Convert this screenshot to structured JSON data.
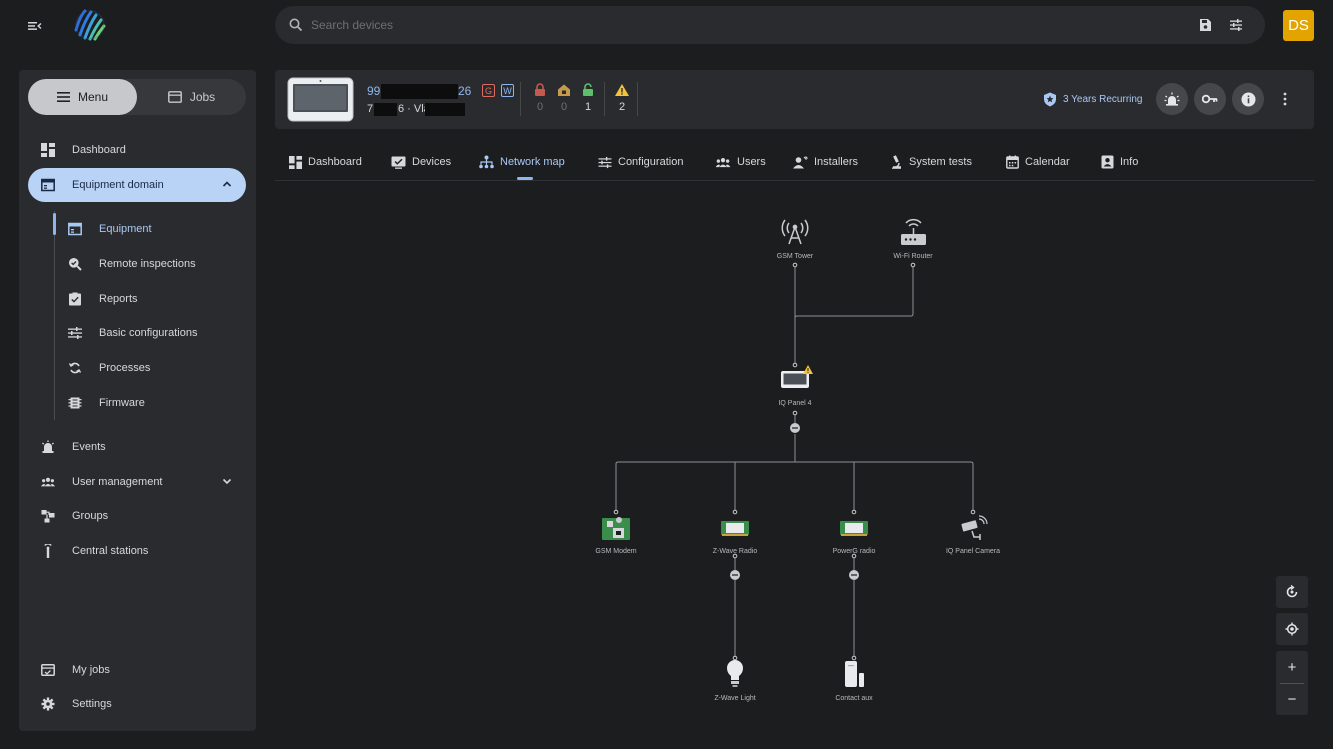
{
  "header": {
    "search_placeholder": "Search devices",
    "avatar_initials": "DS",
    "icons": {
      "menu": "menu-collapse-icon",
      "logo": "brand-logo",
      "search": "search-icon",
      "save": "save-icon",
      "filter": "tune-icon"
    }
  },
  "sidebar": {
    "segment": {
      "menu_label": "Menu",
      "jobs_label": "Jobs",
      "active": "Menu"
    },
    "items": [
      {
        "label": "Dashboard",
        "icon": "dashboard-icon"
      },
      {
        "label": "Equipment domain",
        "icon": "equipment-domain-icon",
        "expanded": true
      },
      {
        "label": "Events",
        "icon": "alarm-icon"
      },
      {
        "label": "User management",
        "icon": "users-icon"
      },
      {
        "label": "Groups",
        "icon": "groups-icon"
      },
      {
        "label": "Central stations",
        "icon": "antenna-icon"
      }
    ],
    "subitems": [
      {
        "label": "Equipment",
        "icon": "equipment-icon",
        "active": true
      },
      {
        "label": "Remote inspections",
        "icon": "search-check-icon"
      },
      {
        "label": "Reports",
        "icon": "report-icon"
      },
      {
        "label": "Basic configurations",
        "icon": "sliders-icon"
      },
      {
        "label": "Processes",
        "icon": "sync-icon"
      },
      {
        "label": "Firmware",
        "icon": "chip-icon"
      }
    ],
    "bottom": [
      {
        "label": "My jobs",
        "icon": "jobs-icon"
      },
      {
        "label": "Settings",
        "icon": "gear-icon"
      }
    ]
  },
  "device": {
    "id_start": "99",
    "id_end": "26",
    "badge_g": "G",
    "badge_w": "W",
    "line2_start": "7",
    "line2_end": "6 · Vla",
    "stats": [
      {
        "icon": "lock-red-icon",
        "value": "0",
        "color": "#c25a4f"
      },
      {
        "icon": "home-lock-icon",
        "value": "0",
        "color": "#c59a4a"
      },
      {
        "icon": "lock-open-icon",
        "value": "1",
        "color": "#5cbf6a"
      },
      {
        "icon": "warning-icon",
        "value": "2",
        "color": "#f3c33c"
      }
    ],
    "subscription": "3 Years Recurring",
    "actions": [
      "alarm-light-icon",
      "key-icon",
      "info-icon",
      "more-vertical-icon"
    ]
  },
  "tabs": [
    {
      "label": "Dashboard",
      "icon": "dashboard-icon"
    },
    {
      "label": "Devices",
      "icon": "devices-icon"
    },
    {
      "label": "Network map",
      "icon": "network-icon",
      "active": true
    },
    {
      "label": "Configuration",
      "icon": "sliders-icon"
    },
    {
      "label": "Users",
      "icon": "users-icon"
    },
    {
      "label": "Installers",
      "icon": "installer-icon"
    },
    {
      "label": "System tests",
      "icon": "microscope-icon"
    },
    {
      "label": "Calendar",
      "icon": "calendar-icon"
    },
    {
      "label": "Info",
      "icon": "contact-icon"
    }
  ],
  "network_map": {
    "nodes": {
      "gsm_tower": "GSM Tower",
      "wifi_router": "Wi-Fi Router",
      "panel": "IQ Panel 4",
      "gsm_modem": "GSM Modem",
      "zwave_radio": "Z-Wave Radio",
      "powerg_radio": "PowerG radio",
      "panel_camera": "IQ Panel Camera",
      "zwave_light": "Z-Wave Light",
      "contact_aux": "Contact aux"
    },
    "panel_warning": true,
    "controls": {
      "zoom_in": "+",
      "zoom_out": "−",
      "icons": [
        "rotate-icon",
        "locate-icon"
      ]
    }
  }
}
